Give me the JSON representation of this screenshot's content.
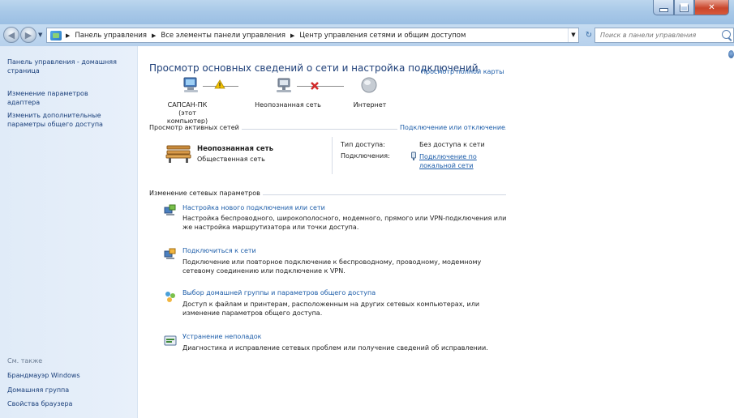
{
  "address": {
    "crumbs": [
      "Панель управления",
      "Все элементы панели управления",
      "Центр управления сетями и общим доступом"
    ],
    "search_placeholder": "Поиск в панели управления"
  },
  "sidebar": {
    "items": [
      {
        "label": "Панель управления - домашняя страница"
      },
      {
        "label": "Изменение параметров адаптера"
      },
      {
        "label": "Изменить дополнительные параметры общего доступа"
      }
    ],
    "see_also_label": "См. также",
    "see_also": [
      {
        "label": "Брандмауэр Windows"
      },
      {
        "label": "Домашняя группа"
      },
      {
        "label": "Свойства браузера"
      }
    ]
  },
  "main": {
    "title": "Просмотр основных сведений о сети и настройка подключений",
    "full_map_link": "Просмотр полной карты",
    "map": {
      "computer": {
        "name": "САПСАН-ПК",
        "sub": "(этот компьютер)"
      },
      "network": {
        "name": "Неопознанная сеть"
      },
      "internet": {
        "name": "Интернет"
      }
    },
    "active_networks_label": "Просмотр активных сетей",
    "connect_disconnect_link": "Подключение или отключение",
    "active_network": {
      "name": "Неопознанная сеть",
      "type": "Общественная сеть",
      "access_type_label": "Тип доступа:",
      "access_type_value": "Без доступа к сети",
      "connections_label": "Подключения:",
      "connections_value": "Подключение по локальной сети"
    },
    "change_settings_label": "Изменение сетевых параметров",
    "tasks": [
      {
        "title": "Настройка нового подключения или сети",
        "desc": "Настройка беспроводного, широкополосного, модемного, прямого или VPN-подключения или же настройка маршрутизатора или точки доступа."
      },
      {
        "title": "Подключиться к сети",
        "desc": "Подключение или повторное подключение к беспроводному, проводному, модемному сетевому соединению или подключение к VPN."
      },
      {
        "title": "Выбор домашней группы и параметров общего доступа",
        "desc": "Доступ к файлам и принтерам, расположенным на других сетевых компьютерах, или изменение параметров общего доступа."
      },
      {
        "title": "Устранение неполадок",
        "desc": "Диагностика и исправление сетевых проблем или получение сведений об исправлении."
      }
    ]
  },
  "colors": {
    "link": "#1a5ba8",
    "title": "#1e3f78",
    "sidebar_bg": "#e0ebf8",
    "titlebar": "#a9c9e8",
    "close": "#c9462c",
    "warning": "#f2c200",
    "error": "#d22a2a"
  }
}
